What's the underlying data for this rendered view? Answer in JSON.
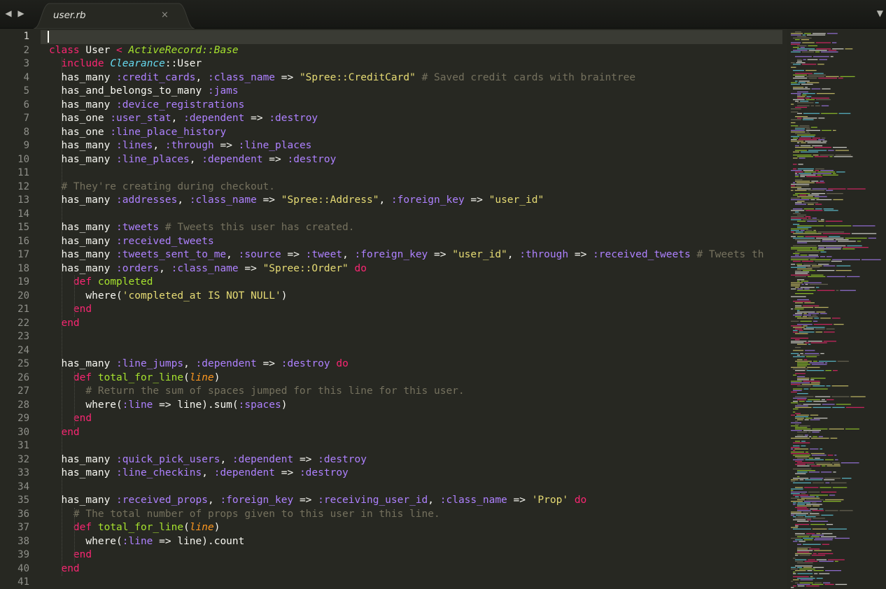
{
  "tabbar": {
    "back_icon": "◀",
    "forward_icon": "▶",
    "active_tab": "user.rb",
    "close_icon": "×",
    "dropdown_icon": "▼"
  },
  "editor": {
    "current_line": 1,
    "palette": {
      "background": "#272822",
      "keyword": "#f92672",
      "symbol": "#ae81ff",
      "string": "#e6db74",
      "comment": "#75715e",
      "function": "#a6e22e",
      "ancestor": "#66d9ef",
      "argument": "#fd971f"
    },
    "line_numbers": [
      "1",
      "2",
      "3",
      "4",
      "5",
      "6",
      "7",
      "8",
      "9",
      "10",
      "11",
      "12",
      "13",
      "14",
      "15",
      "16",
      "17",
      "18",
      "19",
      "20",
      "21",
      "22",
      "23",
      "24",
      "25",
      "26",
      "27",
      "28",
      "29",
      "30",
      "31",
      "32",
      "33",
      "34",
      "35",
      "36",
      "37",
      "38",
      "39",
      "40",
      "41"
    ],
    "lines": [
      [],
      [
        [
          "kw",
          "class"
        ],
        [
          "txt",
          " "
        ],
        [
          "cls",
          "User"
        ],
        [
          "txt",
          " "
        ],
        [
          "kw",
          "<"
        ],
        [
          "txt",
          " "
        ],
        [
          "inh",
          "ActiveRecord::Base"
        ]
      ],
      [
        [
          "txt",
          "  "
        ],
        [
          "kw",
          "include"
        ],
        [
          "txt",
          " "
        ],
        [
          "anc",
          "Clearance"
        ],
        [
          "txt",
          "::User"
        ]
      ],
      [
        [
          "txt",
          "  has_many "
        ],
        [
          "sym",
          ":credit_cards"
        ],
        [
          "txt",
          ", "
        ],
        [
          "sym",
          ":class_name"
        ],
        [
          "txt",
          " => "
        ],
        [
          "str",
          "\"Spree::CreditCard\""
        ],
        [
          "txt",
          " "
        ],
        [
          "com",
          "# Saved credit cards with braintree"
        ]
      ],
      [
        [
          "txt",
          "  has_and_belongs_to_many "
        ],
        [
          "sym",
          ":jams"
        ]
      ],
      [
        [
          "txt",
          "  has_many "
        ],
        [
          "sym",
          ":device_registrations"
        ]
      ],
      [
        [
          "txt",
          "  has_one "
        ],
        [
          "sym",
          ":user_stat"
        ],
        [
          "txt",
          ", "
        ],
        [
          "sym",
          ":dependent"
        ],
        [
          "txt",
          " => "
        ],
        [
          "sym",
          ":destroy"
        ]
      ],
      [
        [
          "txt",
          "  has_one "
        ],
        [
          "sym",
          ":line_place_history"
        ]
      ],
      [
        [
          "txt",
          "  has_many "
        ],
        [
          "sym",
          ":lines"
        ],
        [
          "txt",
          ", "
        ],
        [
          "sym",
          ":through"
        ],
        [
          "txt",
          " => "
        ],
        [
          "sym",
          ":line_places"
        ]
      ],
      [
        [
          "txt",
          "  has_many "
        ],
        [
          "sym",
          ":line_places"
        ],
        [
          "txt",
          ", "
        ],
        [
          "sym",
          ":dependent"
        ],
        [
          "txt",
          " => "
        ],
        [
          "sym",
          ":destroy"
        ]
      ],
      [],
      [
        [
          "txt",
          "  "
        ],
        [
          "com",
          "# They're creating during checkout."
        ]
      ],
      [
        [
          "txt",
          "  has_many "
        ],
        [
          "sym",
          ":addresses"
        ],
        [
          "txt",
          ", "
        ],
        [
          "sym",
          ":class_name"
        ],
        [
          "txt",
          " => "
        ],
        [
          "str",
          "\"Spree::Address\""
        ],
        [
          "txt",
          ", "
        ],
        [
          "sym",
          ":foreign_key"
        ],
        [
          "txt",
          " => "
        ],
        [
          "str",
          "\"user_id\""
        ]
      ],
      [],
      [
        [
          "txt",
          "  has_many "
        ],
        [
          "sym",
          ":tweets"
        ],
        [
          "txt",
          " "
        ],
        [
          "com",
          "# Tweets this user has created."
        ]
      ],
      [
        [
          "txt",
          "  has_many "
        ],
        [
          "sym",
          ":received_tweets"
        ]
      ],
      [
        [
          "txt",
          "  has_many "
        ],
        [
          "sym",
          ":tweets_sent_to_me"
        ],
        [
          "txt",
          ", "
        ],
        [
          "sym",
          ":source"
        ],
        [
          "txt",
          " => "
        ],
        [
          "sym",
          ":tweet"
        ],
        [
          "txt",
          ", "
        ],
        [
          "sym",
          ":foreign_key"
        ],
        [
          "txt",
          " => "
        ],
        [
          "str",
          "\"user_id\""
        ],
        [
          "txt",
          ", "
        ],
        [
          "sym",
          ":through"
        ],
        [
          "txt",
          " => "
        ],
        [
          "sym",
          ":received_tweets"
        ],
        [
          "txt",
          " "
        ],
        [
          "com",
          "# Tweets th"
        ]
      ],
      [
        [
          "txt",
          "  has_many "
        ],
        [
          "sym",
          ":orders"
        ],
        [
          "txt",
          ", "
        ],
        [
          "sym",
          ":class_name"
        ],
        [
          "txt",
          " => "
        ],
        [
          "str",
          "\"Spree::Order\""
        ],
        [
          "txt",
          " "
        ],
        [
          "kw",
          "do"
        ]
      ],
      [
        [
          "txt",
          "    "
        ],
        [
          "kw",
          "def"
        ],
        [
          "txt",
          " "
        ],
        [
          "fn",
          "completed"
        ]
      ],
      [
        [
          "txt",
          "      where("
        ],
        [
          "str",
          "'completed_at IS NOT NULL'"
        ],
        [
          "txt",
          ")"
        ]
      ],
      [
        [
          "txt",
          "    "
        ],
        [
          "kw",
          "end"
        ]
      ],
      [
        [
          "txt",
          "  "
        ],
        [
          "kw",
          "end"
        ]
      ],
      [],
      [],
      [
        [
          "txt",
          "  has_many "
        ],
        [
          "sym",
          ":line_jumps"
        ],
        [
          "txt",
          ", "
        ],
        [
          "sym",
          ":dependent"
        ],
        [
          "txt",
          " => "
        ],
        [
          "sym",
          ":destroy"
        ],
        [
          "txt",
          " "
        ],
        [
          "kw",
          "do"
        ]
      ],
      [
        [
          "txt",
          "    "
        ],
        [
          "kw",
          "def"
        ],
        [
          "txt",
          " "
        ],
        [
          "fn",
          "total_for_line"
        ],
        [
          "txt",
          "("
        ],
        [
          "arg",
          "line"
        ],
        [
          "txt",
          ")"
        ]
      ],
      [
        [
          "txt",
          "      "
        ],
        [
          "com",
          "# Return the sum of spaces jumped for this line for this user."
        ]
      ],
      [
        [
          "txt",
          "      where("
        ],
        [
          "sym",
          ":line"
        ],
        [
          "txt",
          " => line).sum("
        ],
        [
          "sym",
          ":spaces"
        ],
        [
          "txt",
          ")"
        ]
      ],
      [
        [
          "txt",
          "    "
        ],
        [
          "kw",
          "end"
        ]
      ],
      [
        [
          "txt",
          "  "
        ],
        [
          "kw",
          "end"
        ]
      ],
      [],
      [
        [
          "txt",
          "  has_many "
        ],
        [
          "sym",
          ":quick_pick_users"
        ],
        [
          "txt",
          ", "
        ],
        [
          "sym",
          ":dependent"
        ],
        [
          "txt",
          " => "
        ],
        [
          "sym",
          ":destroy"
        ]
      ],
      [
        [
          "txt",
          "  has_many "
        ],
        [
          "sym",
          ":line_checkins"
        ],
        [
          "txt",
          ", "
        ],
        [
          "sym",
          ":dependent"
        ],
        [
          "txt",
          " => "
        ],
        [
          "sym",
          ":destroy"
        ]
      ],
      [],
      [
        [
          "txt",
          "  has_many "
        ],
        [
          "sym",
          ":received_props"
        ],
        [
          "txt",
          ", "
        ],
        [
          "sym",
          ":foreign_key"
        ],
        [
          "txt",
          " => "
        ],
        [
          "sym",
          ":receiving_user_id"
        ],
        [
          "txt",
          ", "
        ],
        [
          "sym",
          ":class_name"
        ],
        [
          "txt",
          " => "
        ],
        [
          "str",
          "'Prop'"
        ],
        [
          "txt",
          " "
        ],
        [
          "kw",
          "do"
        ]
      ],
      [
        [
          "txt",
          "    "
        ],
        [
          "com",
          "# The total number of props given to this user in this line."
        ]
      ],
      [
        [
          "txt",
          "    "
        ],
        [
          "kw",
          "def"
        ],
        [
          "txt",
          " "
        ],
        [
          "fn",
          "total_for_line"
        ],
        [
          "txt",
          "("
        ],
        [
          "arg",
          "line"
        ],
        [
          "txt",
          ")"
        ]
      ],
      [
        [
          "txt",
          "      where("
        ],
        [
          "sym",
          ":line"
        ],
        [
          "txt",
          " => line).count"
        ]
      ],
      [
        [
          "txt",
          "    "
        ],
        [
          "kw",
          "end"
        ]
      ],
      [
        [
          "txt",
          "  "
        ],
        [
          "kw",
          "end"
        ]
      ],
      []
    ]
  }
}
